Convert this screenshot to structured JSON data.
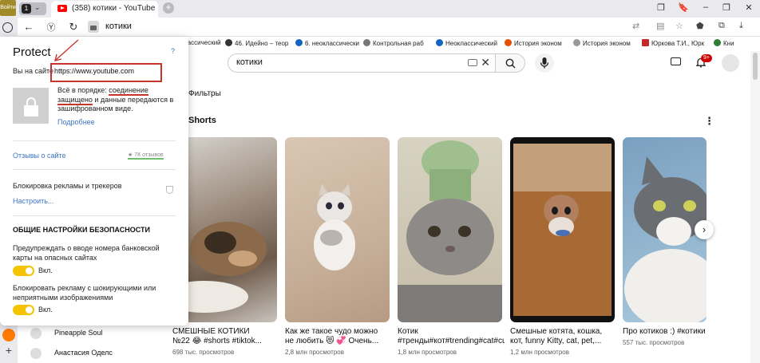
{
  "browser": {
    "login_badge": "Войти",
    "tab_count": "1",
    "tab_title": "(358) котики - YouTube",
    "new_tab": "+",
    "address": "котики",
    "window_buttons": [
      "❐",
      "🔖",
      "–",
      "❐",
      "✕"
    ]
  },
  "bookmarks": [
    {
      "label": "лассический",
      "color": "#d23"
    },
    {
      "label": "46. Идейно – теор",
      "color": "#333"
    },
    {
      "label": "6. неоклассически",
      "color": "#1565c0"
    },
    {
      "label": "Контрольная раб",
      "color": "#777"
    },
    {
      "label": "Неоклассический",
      "color": "#1565c0"
    },
    {
      "label": "История эконом",
      "color": "#e65100"
    },
    {
      "label": "История эконом",
      "color": "#999"
    },
    {
      "label": "Юркова Т.И., Юрк",
      "color": "#c62828"
    },
    {
      "label": "Кни",
      "color": "#2e7d32"
    }
  ],
  "youtube": {
    "search_value": "котики",
    "notif_count": "9+",
    "filters_label": "Фильтры",
    "shorts_label": "Shorts",
    "shorts": [
      {
        "title": "СМЕШНЫЕ КОТИКИ №22 😂 #shorts #tiktok...",
        "views": "698 тыс. просмотров"
      },
      {
        "title": "Как же такое чудо можно не любить 😻 💞 Очень...",
        "views": "2,8 млн просмотров"
      },
      {
        "title": "Котик #тренды#кот#trending#cat#cute",
        "views": "1,8 млн просмотров"
      },
      {
        "title": "Смешные котята, кошка, кот, funny Kitty, cat, pet,...",
        "views": "1,2 млн просмотров"
      },
      {
        "title": "Про котиков :) #котики",
        "views": "557 тыс. просмотров"
      }
    ],
    "sidebar": [
      "Pineapple Soul",
      "Анастасия Оделс"
    ]
  },
  "protect": {
    "title": "Protect",
    "help": "?",
    "on_site": "Вы на сайте",
    "url": "https://www.youtube.com",
    "status_prefix": "Всё в порядке: ",
    "status_link_1": "соединение",
    "status_link_2": "защищено",
    "status_suffix": " и данные передаются в зашифрованном виде.",
    "more_link": "Подробнее",
    "reviews_link": "Отзывы о сайте",
    "reviews_rating": "★ 7К отзывов",
    "adblock_label": "Блокировка рекламы и трекеров",
    "setup_link": "Настроить...",
    "section_title": "ОБЩИЕ НАСТРОЙКИ БЕЗОПАСНОСТИ",
    "option_1": "Предупреждать о вводе номера банковской карты на опасных сайтах",
    "option_1_state": "Вкл.",
    "option_2": "Блокировать рекламу с шокирующими или неприятными изображениями",
    "option_2_state": "Вкл."
  }
}
